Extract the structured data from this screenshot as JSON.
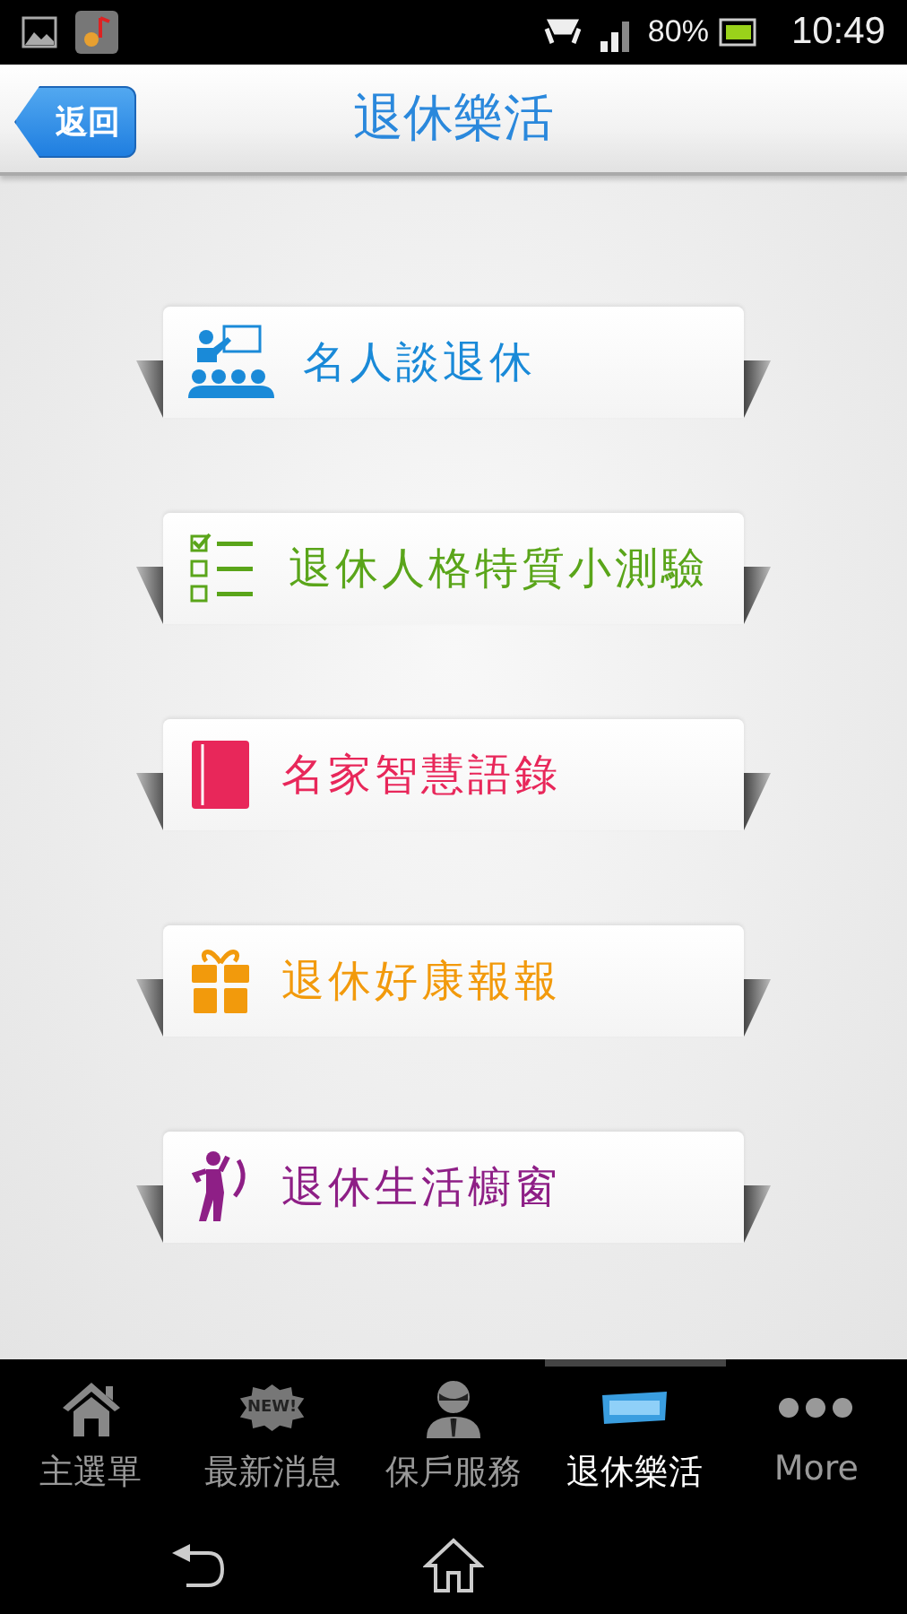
{
  "status_bar": {
    "battery": "80%",
    "time": "10:49"
  },
  "header": {
    "back": "返回",
    "title": "退休樂活"
  },
  "menu": [
    {
      "kind": "speaker",
      "label": "名人談退休",
      "color": "#1a8ad8"
    },
    {
      "kind": "checklist",
      "label": "退休人格特質小測驗",
      "color": "#5aa51a"
    },
    {
      "kind": "book",
      "label": "名家智慧語錄",
      "color": "#e8275a"
    },
    {
      "kind": "gift",
      "label": "退休好康報報",
      "color": "#f29a0c"
    },
    {
      "kind": "golfer",
      "label": "退休生活櫥窗",
      "color": "#8e1f86"
    }
  ],
  "tabs": [
    {
      "kind": "home",
      "label": "主選單",
      "selected": false
    },
    {
      "kind": "new",
      "label": "最新消息",
      "badge": "NEW!",
      "selected": false
    },
    {
      "kind": "agent",
      "label": "保戶服務",
      "selected": false
    },
    {
      "kind": "banner",
      "label": "退休樂活",
      "selected": true
    },
    {
      "kind": "more",
      "label": "More",
      "selected": false
    }
  ]
}
